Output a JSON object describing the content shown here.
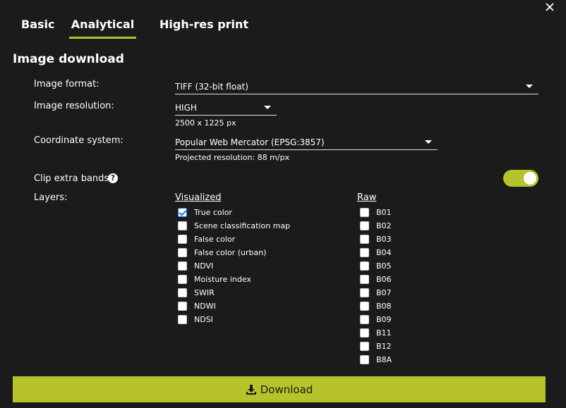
{
  "tabs": [
    {
      "label": "Basic",
      "active": false
    },
    {
      "label": "Analytical",
      "active": true
    },
    {
      "label": "High-res print",
      "active": false
    }
  ],
  "section_title": "Image download",
  "fields": {
    "format_label": "Image format:",
    "format_value": "TIFF (32-bit float)",
    "resolution_label": "Image resolution:",
    "resolution_value": "HIGH",
    "resolution_sub": "2500 x 1225 px",
    "crs_label": "Coordinate system:",
    "crs_value": "Popular Web Mercator (EPSG:3857)",
    "crs_sub": "Projected resolution: 88 m/px",
    "clip_label": "Clip extra bands",
    "clip_enabled": true,
    "layers_label": "Layers:"
  },
  "visualized": {
    "header": "Visualized",
    "items": [
      {
        "label": "True color",
        "checked": true
      },
      {
        "label": "Scene classification map",
        "checked": false
      },
      {
        "label": "False color",
        "checked": false
      },
      {
        "label": "False color (urban)",
        "checked": false
      },
      {
        "label": "NDVI",
        "checked": false
      },
      {
        "label": "Moisture index",
        "checked": false
      },
      {
        "label": "SWIR",
        "checked": false
      },
      {
        "label": "NDWI",
        "checked": false
      },
      {
        "label": "NDSI",
        "checked": false
      }
    ]
  },
  "raw": {
    "header": "Raw",
    "items": [
      {
        "label": "B01",
        "checked": false
      },
      {
        "label": "B02",
        "checked": false
      },
      {
        "label": "B03",
        "checked": false
      },
      {
        "label": "B04",
        "checked": false
      },
      {
        "label": "B05",
        "checked": false
      },
      {
        "label": "B06",
        "checked": false
      },
      {
        "label": "B07",
        "checked": false
      },
      {
        "label": "B08",
        "checked": false
      },
      {
        "label": "B09",
        "checked": false
      },
      {
        "label": "B11",
        "checked": false
      },
      {
        "label": "B12",
        "checked": false
      },
      {
        "label": "B8A",
        "checked": false
      }
    ]
  },
  "download_label": "Download",
  "colors": {
    "accent": "#b6c32a",
    "background": "#1b1b1b"
  },
  "icons": {
    "close": "close-icon",
    "help": "help-icon",
    "download": "download-icon"
  }
}
